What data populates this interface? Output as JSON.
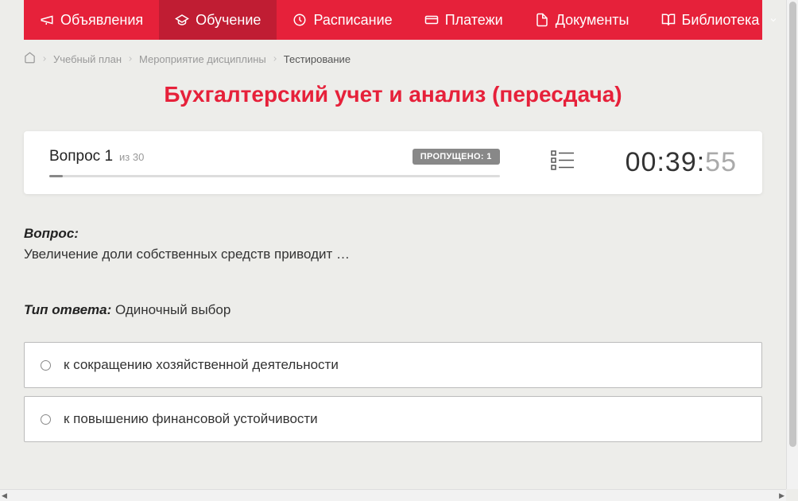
{
  "nav": {
    "items": [
      {
        "label": "Объявления",
        "icon": "megaphone"
      },
      {
        "label": "Обучение",
        "icon": "grad-cap",
        "active": true
      },
      {
        "label": "Расписание",
        "icon": "clock"
      },
      {
        "label": "Платежи",
        "icon": "card"
      },
      {
        "label": "Документы",
        "icon": "doc"
      },
      {
        "label": "Библиотека",
        "icon": "book",
        "dropdown": true
      }
    ]
  },
  "breadcrumbs": {
    "items": [
      "Учебный план",
      "Мероприятие дисциплины",
      "Тестирование"
    ]
  },
  "page_title": "Бухгалтерский учет и анализ (пересдача)",
  "question_bar": {
    "question_label": "Вопрос 1",
    "of_label": "из 30",
    "badge": "ПРОПУЩЕНО: 1",
    "timer_main": "00:39:",
    "timer_sec": "55"
  },
  "question": {
    "label": "Вопрос:",
    "text": "Увеличение доли собственных средств приводит …"
  },
  "answer_type": {
    "label": "Тип ответа:",
    "value": "Одиночный выбор"
  },
  "answers": [
    {
      "text": "к сокращению хозяйственной деятельности"
    },
    {
      "text": "к повышению финансовой устойчивости"
    }
  ]
}
